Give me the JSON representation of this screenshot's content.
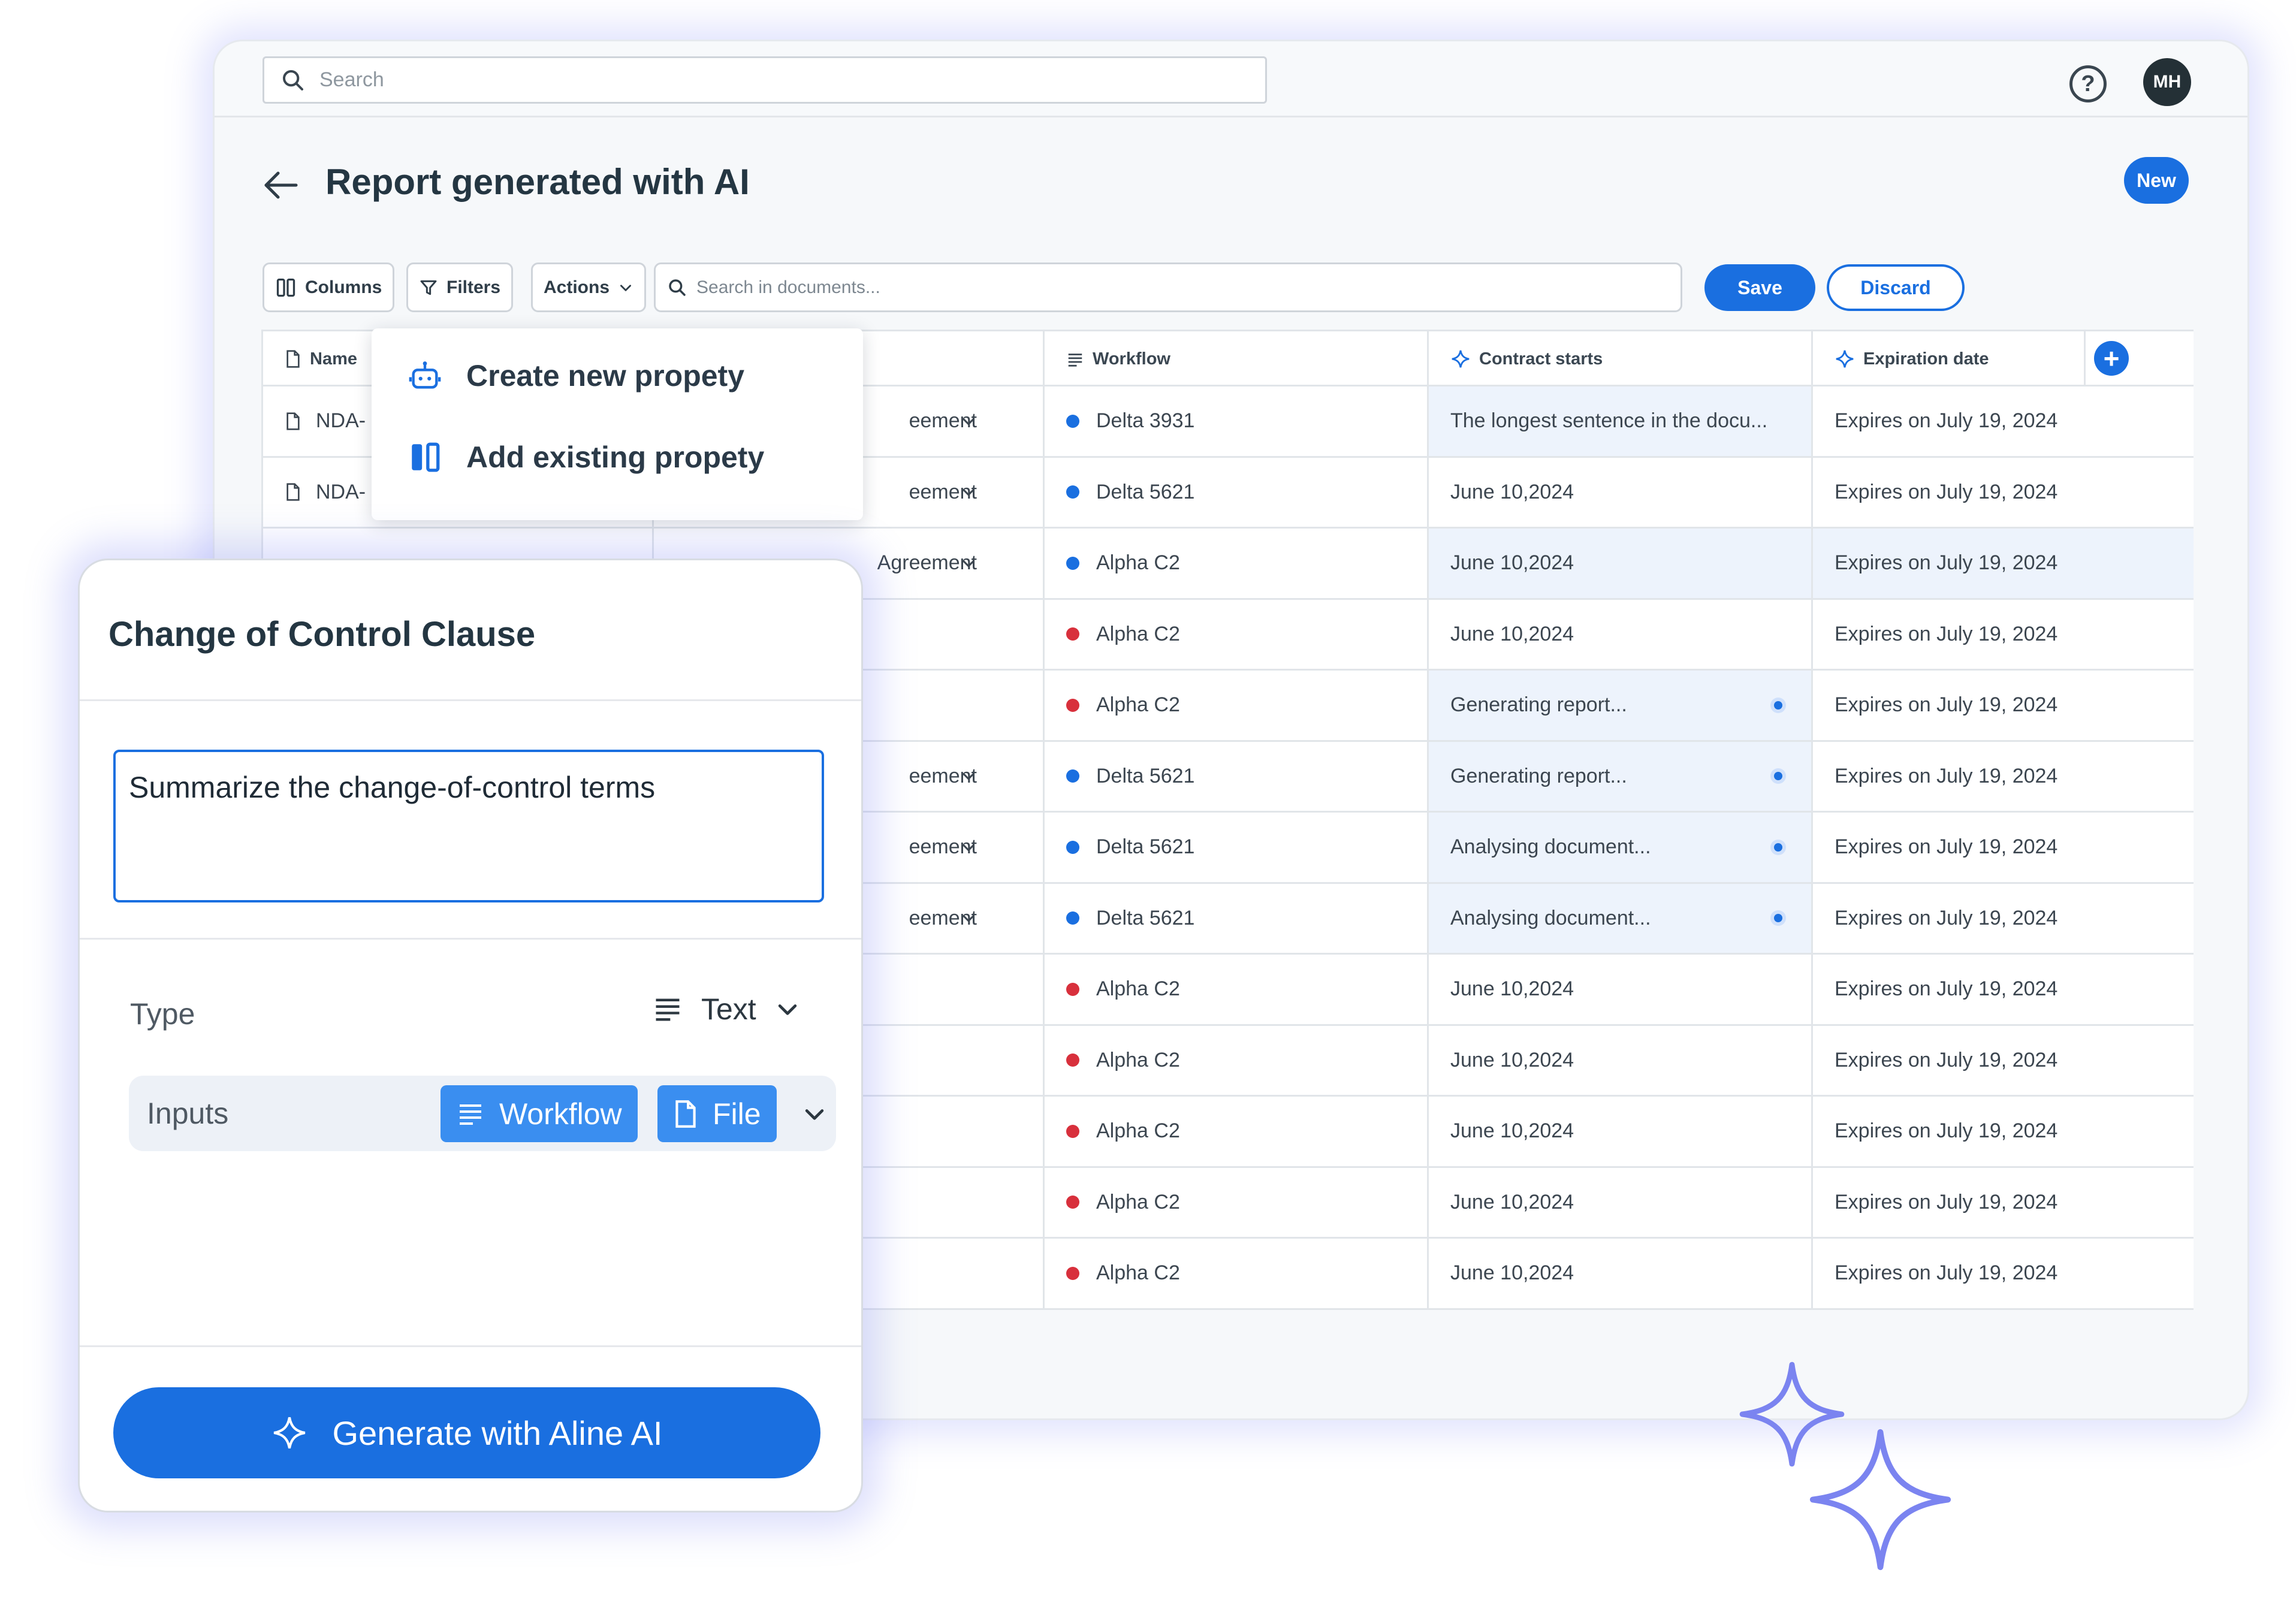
{
  "topbar": {
    "search_placeholder": "Search",
    "user_initials": "MH"
  },
  "page": {
    "title": "Report generated with AI",
    "new_badge": "New"
  },
  "toolbar": {
    "columns_label": "Columns",
    "filters_label": "Filters",
    "actions_label": "Actions",
    "doc_search_placeholder": "Search in documents...",
    "save_label": "Save",
    "discard_label": "Discard"
  },
  "table": {
    "headers": {
      "name": "Name",
      "workflow": "Workflow",
      "contract_starts": "Contract starts",
      "expiration_date": "Expiration date"
    },
    "rows": [
      {
        "name": "NDA-",
        "type": "eement",
        "workflow": "Delta 3931",
        "status": "blue",
        "contract": "The longest sentence in the docu...",
        "contract_hl": true,
        "generating": false,
        "expires": "Expires on July 19, 2024"
      },
      {
        "name": "NDA-",
        "type": "eement",
        "workflow": "Delta 5621",
        "status": "blue",
        "contract": "June 10,2024",
        "contract_hl": false,
        "generating": false,
        "expires": "Expires on July 19, 2024"
      },
      {
        "name": "",
        "type": "Agreement",
        "workflow": "Alpha C2",
        "status": "blue",
        "contract": "June 10,2024",
        "contract_hl": true,
        "generating": false,
        "expires": "Expires on July 19, 2024"
      },
      {
        "name": "",
        "type": "",
        "workflow": "Alpha C2",
        "status": "red",
        "contract": "June 10,2024",
        "contract_hl": false,
        "generating": false,
        "expires": "Expires on July 19, 2024"
      },
      {
        "name": "",
        "type": "",
        "workflow": "Alpha C2",
        "status": "red",
        "contract": "Generating report...",
        "contract_hl": true,
        "generating": true,
        "expires": "Expires on July 19, 2024"
      },
      {
        "name": "",
        "type": "eement",
        "workflow": "Delta 5621",
        "status": "blue",
        "contract": "Generating report...",
        "contract_hl": true,
        "generating": true,
        "expires": "Expires on July 19, 2024"
      },
      {
        "name": "",
        "type": "eement",
        "workflow": "Delta 5621",
        "status": "blue",
        "contract": "Analysing document...",
        "contract_hl": true,
        "generating": true,
        "expires": "Expires on July 19, 2024"
      },
      {
        "name": "",
        "type": "eement",
        "workflow": "Delta 5621",
        "status": "blue",
        "contract": "Analysing document...",
        "contract_hl": true,
        "generating": true,
        "expires": "Expires on July 19, 2024"
      },
      {
        "name": "",
        "type": "",
        "workflow": "Alpha C2",
        "status": "red",
        "contract": "June 10,2024",
        "contract_hl": false,
        "generating": false,
        "expires": "Expires on July 19, 2024"
      },
      {
        "name": "",
        "type": "",
        "workflow": "Alpha C2",
        "status": "red",
        "contract": "June 10,2024",
        "contract_hl": false,
        "generating": false,
        "expires": "Expires on July 19, 2024"
      },
      {
        "name": "",
        "type": "",
        "workflow": "Alpha C2",
        "status": "red",
        "contract": "June 10,2024",
        "contract_hl": false,
        "generating": false,
        "expires": "Expires on July 19, 2024"
      },
      {
        "name": "",
        "type": "",
        "workflow": "Alpha C2",
        "status": "red",
        "contract": "June 10,2024",
        "contract_hl": false,
        "generating": false,
        "expires": "Expires on July 19, 2024"
      },
      {
        "name": "",
        "type": "",
        "workflow": "Alpha C2",
        "status": "red",
        "contract": "June 10,2024",
        "contract_hl": false,
        "generating": false,
        "expires": "Expires on July 19, 2024"
      }
    ]
  },
  "menu": {
    "create_label": "Create new propety",
    "add_label": "Add existing propety"
  },
  "panel": {
    "title": "Change of Control Clause",
    "prompt_value": "Summarize the change-of-control terms",
    "type_label": "Type",
    "type_value": "Text",
    "inputs_label": "Inputs",
    "chip_workflow": "Workflow",
    "chip_file": "File",
    "generate_label": "Generate with Aline AI"
  },
  "colors": {
    "accent": "#1a6fe0",
    "status_blue": "#1a6fe0",
    "status_red": "#d8303c",
    "sparkle": "#7b84f0"
  }
}
